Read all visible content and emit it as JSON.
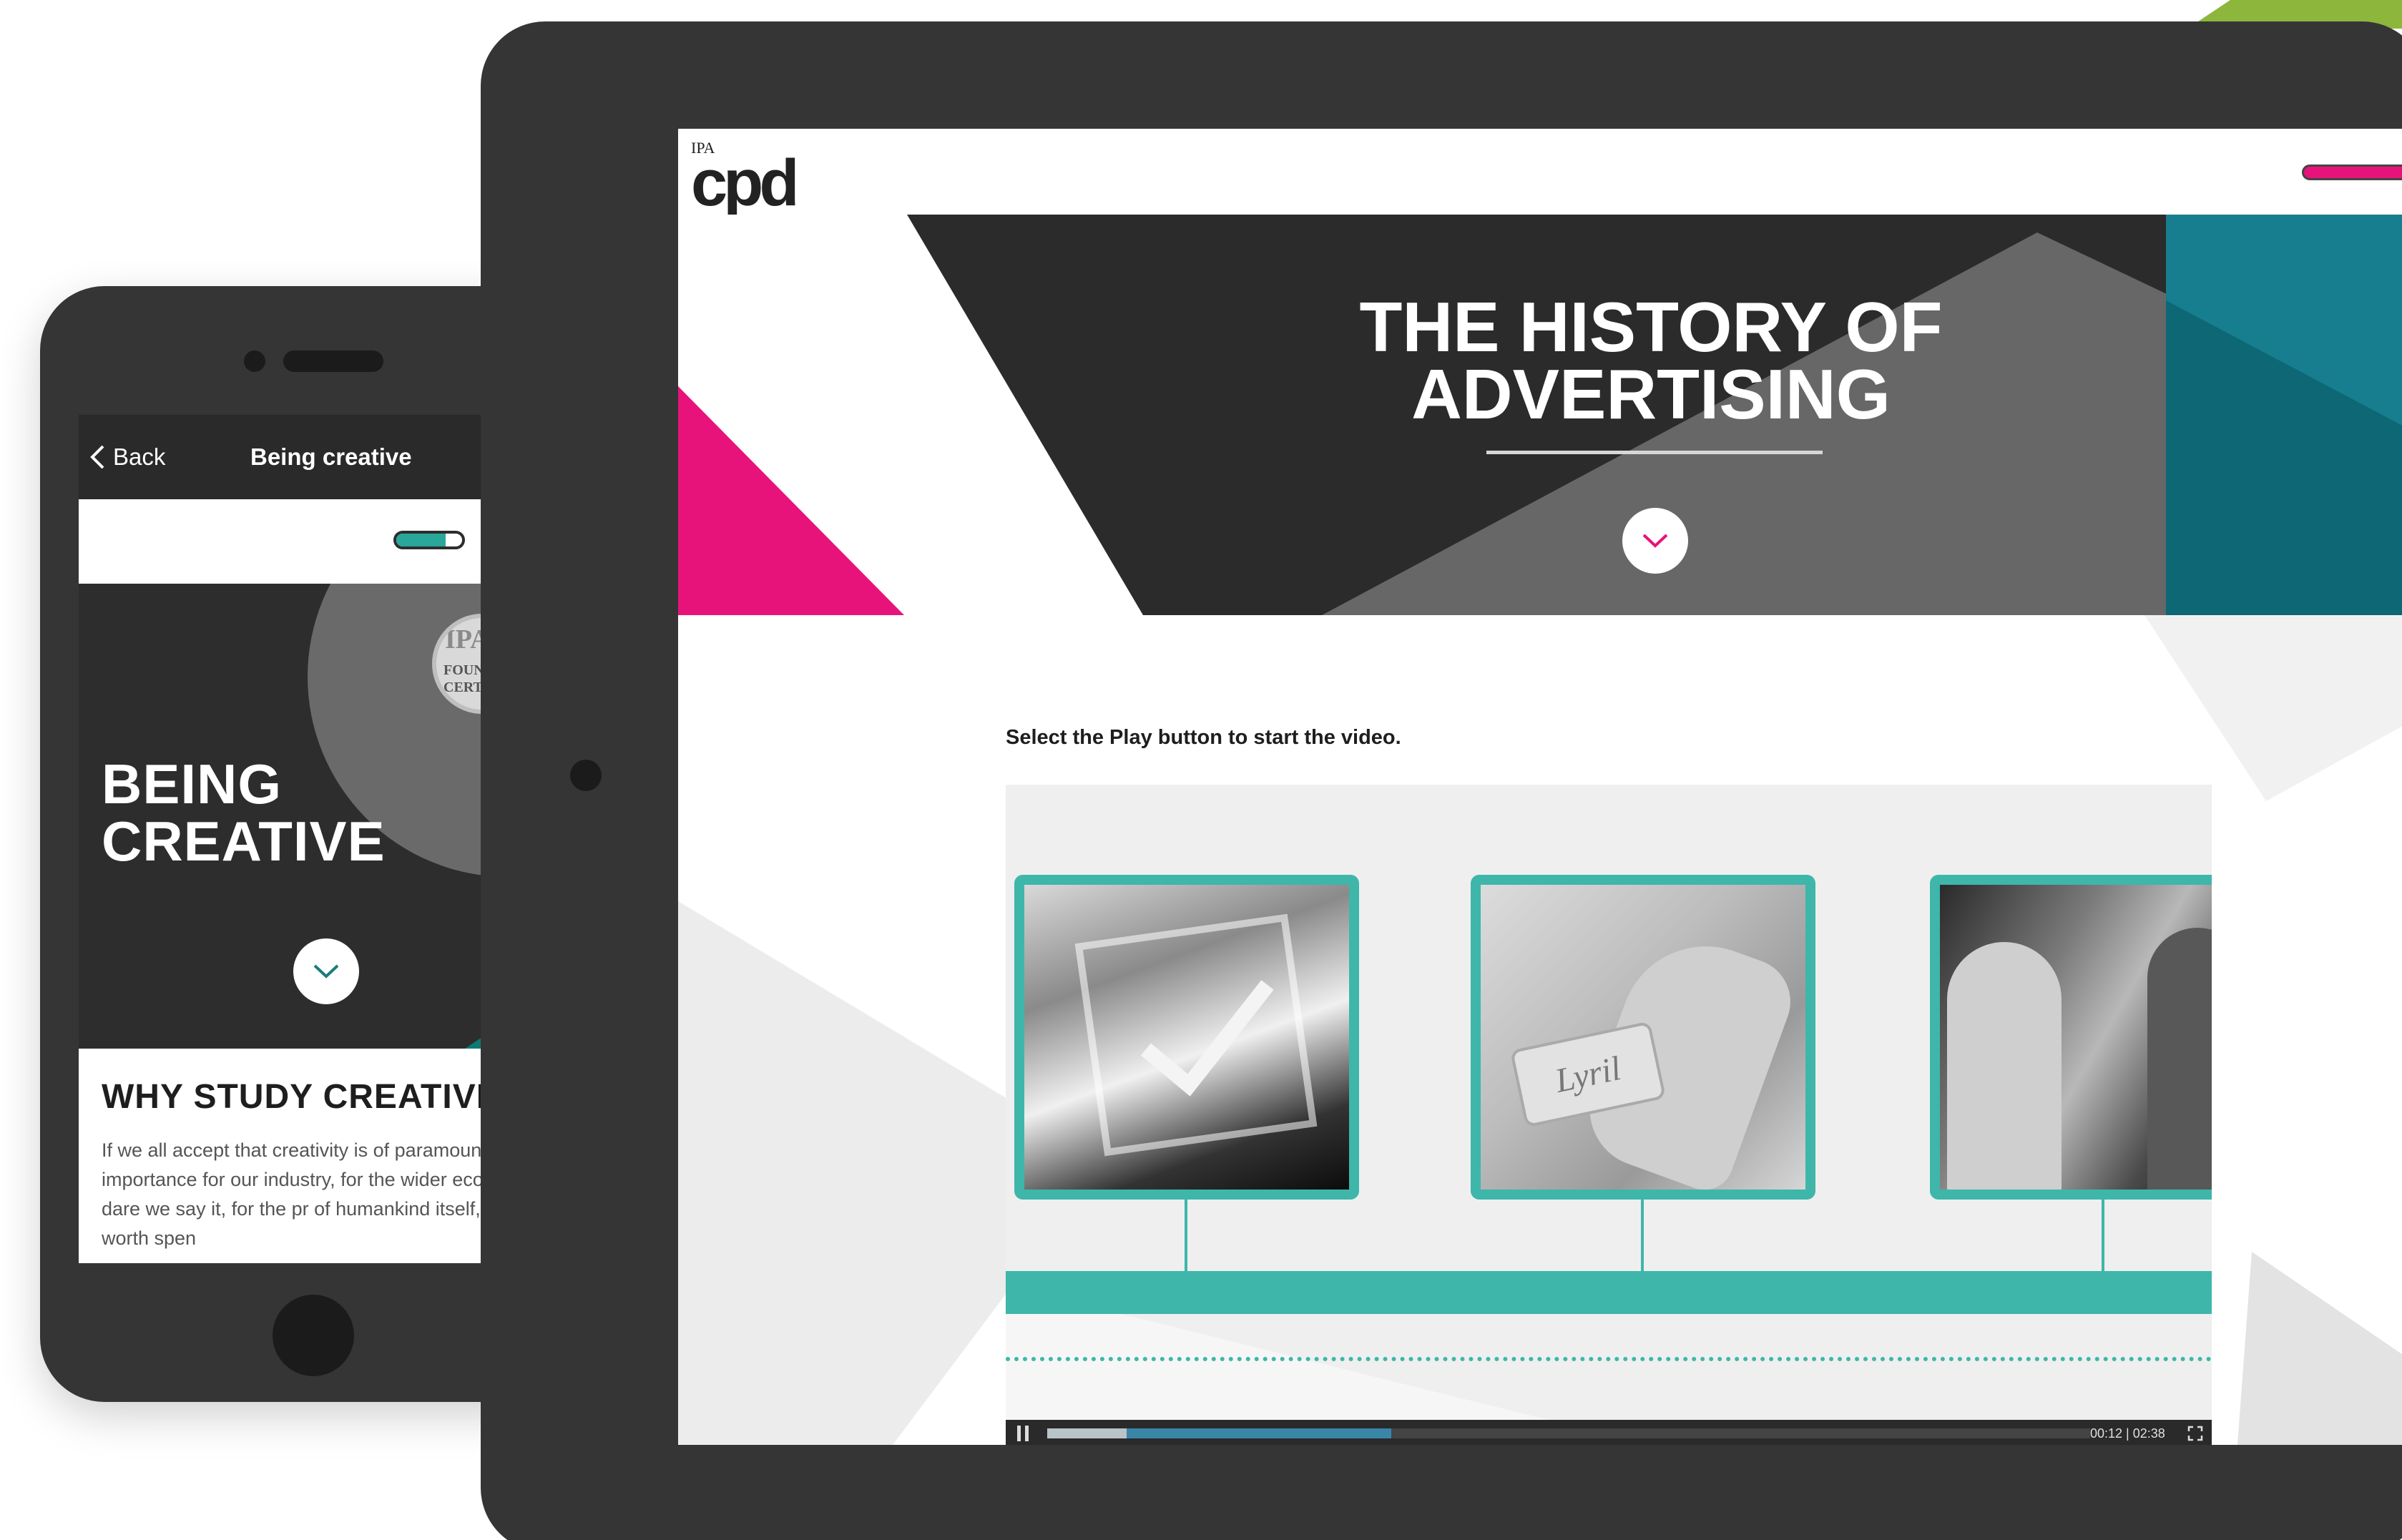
{
  "phone": {
    "nav": {
      "back_label": "Back",
      "title": "Being creative"
    },
    "progress": 0.75,
    "badge": {
      "org": "IPA",
      "line1": "FOUN",
      "line2": "CERT"
    },
    "hero": {
      "title_line1": "BEING",
      "title_line2": "CREATIVE"
    },
    "section": {
      "heading": "WHY STUDY CREATIVI",
      "paragraph": "If we all accept that creativity is of paramount importance for our industry, for the wider economy and, dare we say it, for the pr of humankind itself, then it's worth spen"
    }
  },
  "tablet": {
    "logo": {
      "small": "IPA",
      "main": "cpd"
    },
    "hero": {
      "title_line1": "THE HISTORY OF",
      "title_line2": "ADVERTISING"
    },
    "instruction": "Select the Play button to start the video.",
    "video": {
      "soap_brand": "Lyril",
      "current_time": "00:12",
      "duration": "02:38",
      "time_display": "00:12 | 02:38",
      "played_fraction": 0.076,
      "buffered_fraction": 0.33
    }
  },
  "colors": {
    "teal": "#3fb6aa",
    "magenta": "#e8137a",
    "dark": "#2b2b2b",
    "device": "#353535",
    "hero_teal": "#177e8f",
    "accent_green": "#8cb63c"
  },
  "icons": [
    "chevron-left-icon",
    "chevron-down-icon",
    "pause-icon",
    "fullscreen-icon"
  ]
}
